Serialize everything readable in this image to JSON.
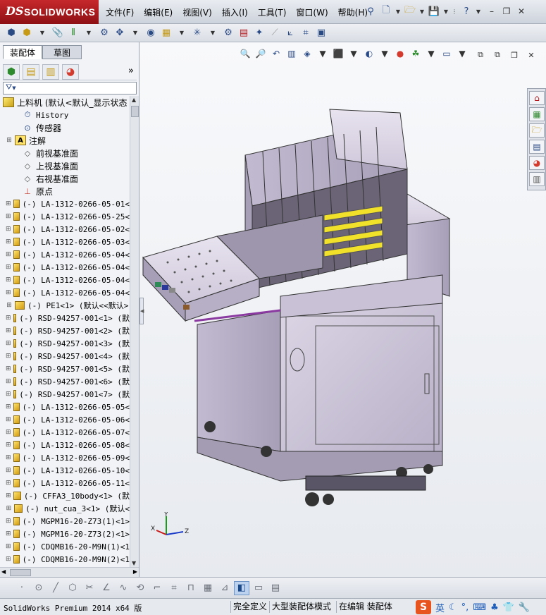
{
  "app": {
    "logo_ds": "DS",
    "logo_name": "SOLIDWORKS",
    "icons": [
      "new-document-icon",
      "open-folder-icon",
      "save-icon",
      "help-icon"
    ]
  },
  "menu": [
    {
      "label": "文件(F)"
    },
    {
      "label": "编辑(E)"
    },
    {
      "label": "视图(V)"
    },
    {
      "label": "插入(I)"
    },
    {
      "label": "工具(T)"
    },
    {
      "label": "窗口(W)"
    },
    {
      "label": "帮助(H)"
    }
  ],
  "panel": {
    "tabs": [
      {
        "label": "装配体",
        "active": true
      },
      {
        "label": "草图",
        "active": false
      }
    ],
    "more_glyph": "»",
    "filter_glyph": "▼"
  },
  "tree": {
    "root": "上料机  (默认<默认_显示状态",
    "features": [
      {
        "label": "History",
        "icon": "history-icon"
      },
      {
        "label": "传感器",
        "icon": "sensor-icon"
      },
      {
        "label": "注解",
        "icon": "annotation-icon"
      },
      {
        "label": "前视基准面",
        "icon": "plane-icon"
      },
      {
        "label": "上视基准面",
        "icon": "plane-icon"
      },
      {
        "label": "右视基准面",
        "icon": "plane-icon"
      },
      {
        "label": "原点",
        "icon": "origin-icon"
      }
    ],
    "components": [
      "(-) LA-1312-0266-05-01<",
      "(-) LA-1312-0266-05-25<",
      "(-) LA-1312-0266-05-02<",
      "(-) LA-1312-0266-05-03<",
      "(-) LA-1312-0266-05-04<",
      "(-) LA-1312-0266-05-04<",
      "(-) LA-1312-0266-05-04<",
      "(-) LA-1312-0266-05-04<",
      "(-) PE1<1> (默认<<默认>",
      "(-) RSD-94257-001<1> (默",
      "(-) RSD-94257-001<2> (默",
      "(-) RSD-94257-001<3> (默",
      "(-) RSD-94257-001<4> (默",
      "(-) RSD-94257-001<5> (默",
      "(-) RSD-94257-001<6> (默",
      "(-) RSD-94257-001<7> (默",
      "(-) LA-1312-0266-05-05<",
      "(-) LA-1312-0266-05-06<",
      "(-) LA-1312-0266-05-07<",
      "(-) LA-1312-0266-05-08<",
      "(-) LA-1312-0266-05-09<",
      "(-) LA-1312-0266-05-10<",
      "(-) LA-1312-0266-05-11<",
      "(-) CFFA3_10body<1> (默",
      "(-) nut_cua_3<1> (默认<",
      "(-) MGPM16-20-Z73(1)<1>",
      "(-) MGPM16-20-Z73(2)<1>",
      "(-) CDQMB16-20-M9N(1)<1",
      "(-) CDQMB16-20-M9N(2)<1"
    ]
  },
  "triad": {
    "x": "X",
    "y": "Y",
    "z": "Z"
  },
  "status": {
    "app": "SolidWorks Premium 2014 x64 版",
    "fields": [
      "完全定义",
      "大型装配体模式",
      "在编辑 装配体"
    ],
    "ime_logo": "S",
    "ime_lang": "英"
  },
  "colors": {
    "accent_red": "#b5161c",
    "machine_body": "#c9c2d6",
    "machine_yellow": "#f2e12a"
  }
}
